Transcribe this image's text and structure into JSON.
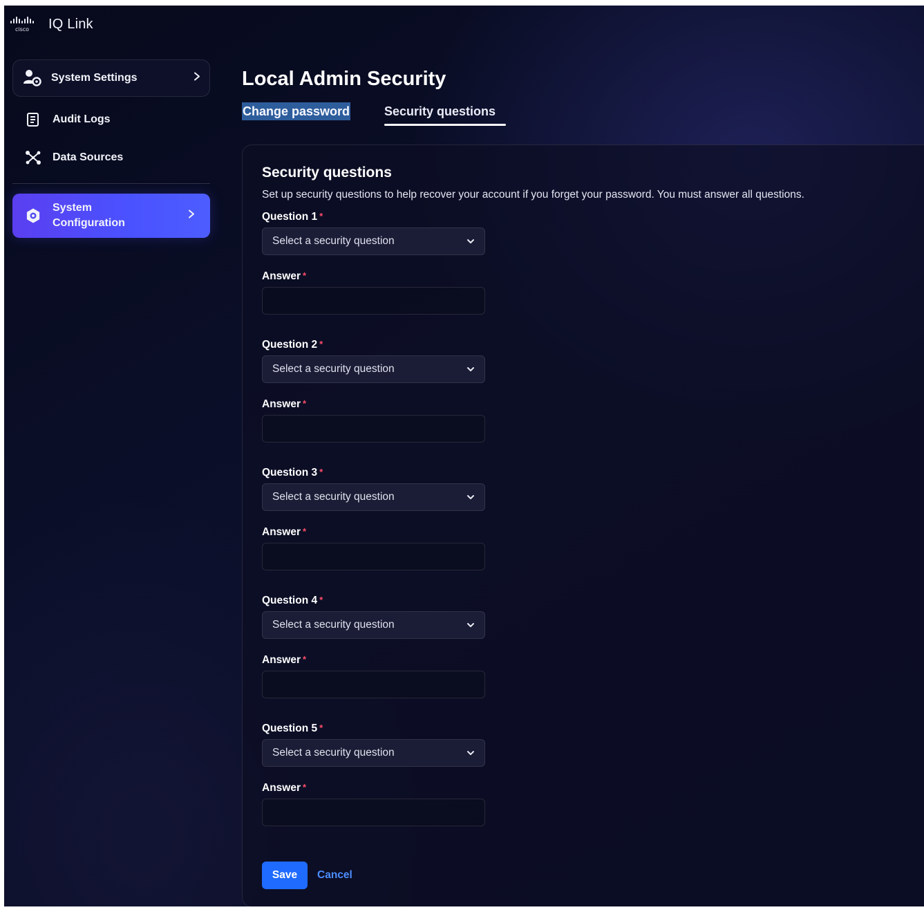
{
  "app": {
    "title": "IQ Link",
    "brand_logo": "cisco-logo"
  },
  "sidebar": {
    "items": [
      {
        "label": "System Settings",
        "icon": "user-gear-icon",
        "has_chevron": true,
        "active": false
      },
      {
        "label": "Audit Logs",
        "icon": "document-icon",
        "has_chevron": false,
        "active": false
      },
      {
        "label": "Data Sources",
        "icon": "network-nodes-icon",
        "has_chevron": false,
        "active": false
      },
      {
        "label": "System Configuration",
        "icon": "gear-icon",
        "has_chevron": true,
        "active": true
      }
    ]
  },
  "page": {
    "title": "Local Admin Security",
    "tabs": [
      {
        "label": "Change password",
        "active": false
      },
      {
        "label": "Security questions",
        "active": true
      }
    ]
  },
  "card": {
    "title": "Security questions",
    "description": "Set up security questions to help recover your account if you forget your password. You must answer all questions.",
    "required_marker": "*",
    "questions": [
      {
        "label": "Question 1",
        "placeholder": "Select a security question",
        "answer_label": "Answer",
        "answer_value": ""
      },
      {
        "label": "Question 2",
        "placeholder": "Select a security question",
        "answer_label": "Answer",
        "answer_value": ""
      },
      {
        "label": "Question 3",
        "placeholder": "Select a security question",
        "answer_label": "Answer",
        "answer_value": ""
      },
      {
        "label": "Question 4",
        "placeholder": "Select a security question",
        "answer_label": "Answer",
        "answer_value": ""
      },
      {
        "label": "Question 5",
        "placeholder": "Select a security question",
        "answer_label": "Answer",
        "answer_value": ""
      }
    ],
    "actions": {
      "save_label": "Save",
      "cancel_label": "Cancel"
    }
  },
  "colors": {
    "accent": "#1f6bff",
    "nav_active_start": "#5a3ff0",
    "nav_active_end": "#4d5dff",
    "required": "#ff4d6a",
    "link": "#4c8dff",
    "background": "#0b0f2a"
  }
}
